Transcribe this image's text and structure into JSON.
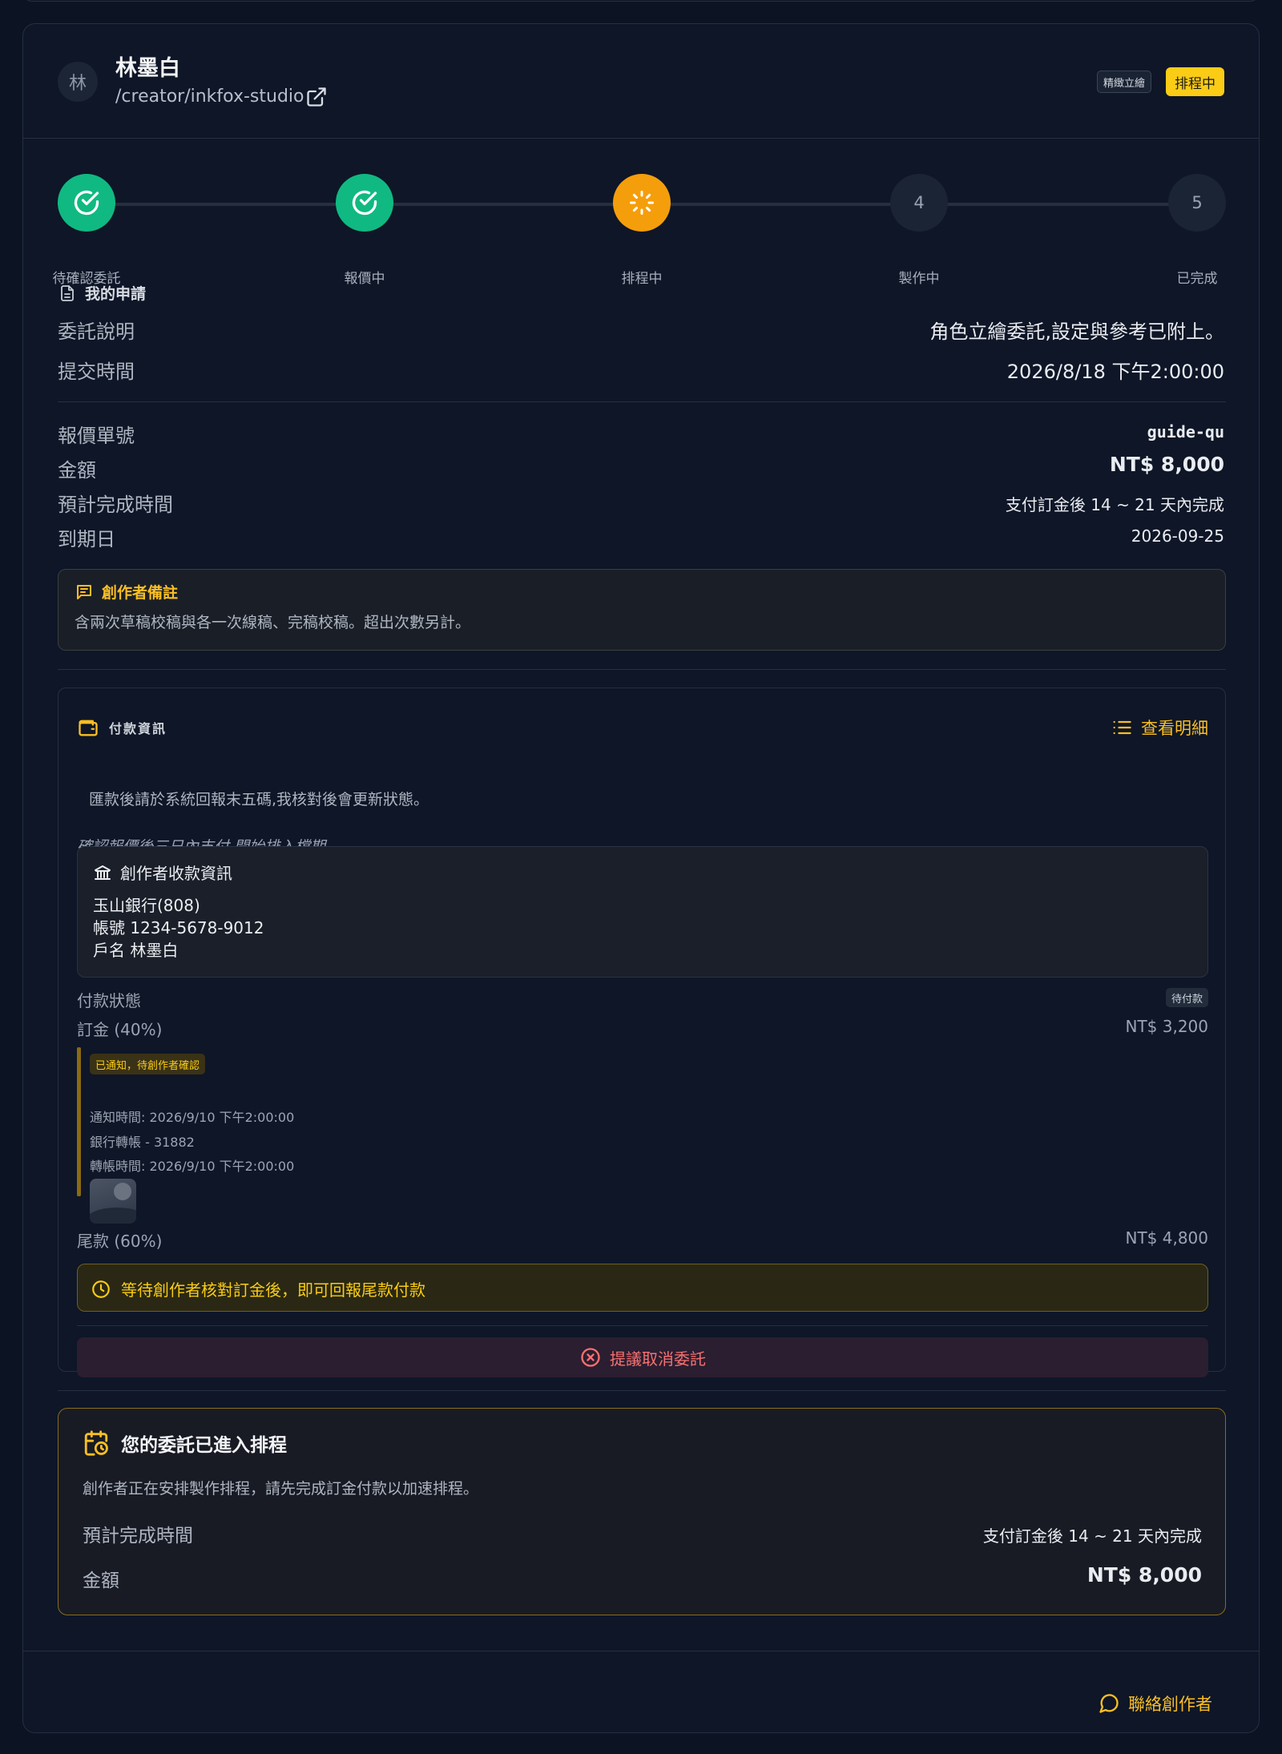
{
  "creator": {
    "avatar_initial": "林",
    "name": "林墨白",
    "link": "/creator/inkfox-studio",
    "category_tag": "精緻立繪",
    "status_tag": "排程中"
  },
  "steps": [
    {
      "label": "待確認委託",
      "state": "done",
      "number": ""
    },
    {
      "label": "報價中",
      "state": "done",
      "number": ""
    },
    {
      "label": "排程中",
      "state": "active",
      "number": ""
    },
    {
      "label": "製作中",
      "state": "pending",
      "number": "4"
    },
    {
      "label": "已完成",
      "state": "pending",
      "number": "5"
    }
  ],
  "request": {
    "title": "我的申請",
    "desc_label": "委託說明",
    "desc_value": "角色立繪委託,設定與參考已附上。",
    "submit_label": "提交時間",
    "submit_value": "2026/8/18 下午2:00:00"
  },
  "quote": {
    "number_label": "報價單號",
    "number_value": "guide-qu",
    "amount_label": "金額",
    "amount_value": "NT$ 8,000",
    "eta_label": "預計完成時間",
    "eta_value": "支付訂金後 14 ~ 21 天內完成",
    "due_label": "到期日",
    "due_value": "2026-09-25"
  },
  "creator_note": {
    "title": "創作者備註",
    "body": "含兩次草稿校稿與各一次線稿、完稿校稿。超出次數另計。"
  },
  "payment": {
    "title": "付款資訊",
    "detail_link": "查看明細",
    "instruction": "匯款後請於系統回報末五碼,我核對後會更新狀態。",
    "terms": "確認報價後三日內支付,開始排入檔期。",
    "bank": {
      "title": "創作者收款資訊",
      "bank_name": "玉山銀行(808)",
      "account": "帳號 1234-5678-9012",
      "holder": "戶名 林墨白"
    },
    "status_label": "付款狀態",
    "status_badge": "待付款",
    "deposit_label": "訂金 (40%)",
    "deposit_amount": "NT$ 3,200",
    "deposit_notice_badge": "已通知，待創作者確認",
    "notify_time": "通知時間: 2026/9/10 下午2:00:00",
    "transfer_method": "銀行轉帳 - 31882",
    "transfer_time": "轉帳時間: 2026/9/10 下午2:00:00",
    "final_label": "尾款 (60%)",
    "final_amount": "NT$ 4,800",
    "waiting_text": "等待創作者核對訂金後，即可回報尾款付款",
    "cancel_button": "提議取消委託"
  },
  "schedule": {
    "title": "您的委託已進入排程",
    "desc": "創作者正在安排製作排程，請先完成訂金付款以加速排程。",
    "eta_label": "預計完成時間",
    "eta_value": "支付訂金後 14 ~ 21 天內完成",
    "amount_label": "金額",
    "amount_value": "NT$ 8,000"
  },
  "footer": {
    "contact": "聯絡創作者"
  },
  "colors": {
    "accent": "#fbbf24",
    "success": "#10b981",
    "active": "#f59e0b",
    "danger": "#f87171",
    "background": "#0c1424"
  }
}
